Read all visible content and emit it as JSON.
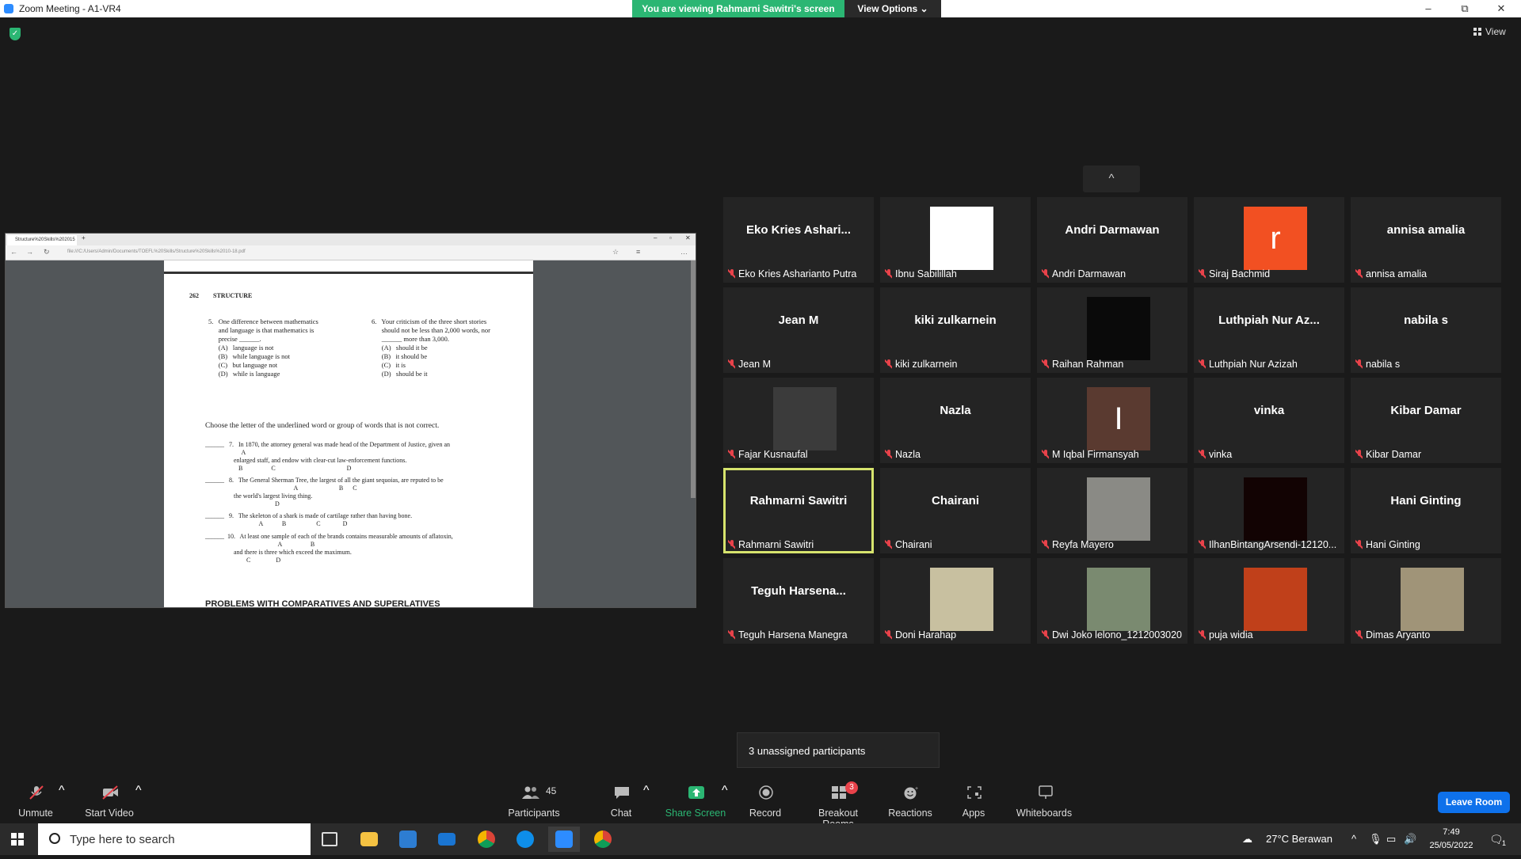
{
  "window": {
    "title": "Zoom Meeting - A1-VR4",
    "banner": "You are viewing Rahmarni Sawitri's screen",
    "view_options": "View Options ⌄",
    "view_label": "View",
    "controls": [
      "–",
      "⧉",
      "✕"
    ]
  },
  "shared_screen": {
    "tab_title": "Structure%20Skills%202015",
    "url": "file:///C:/Users/Admin/Documents/TOEFL%20Skills/Structure%20Skills%2010-18.pdf",
    "page_number": "262",
    "section": "STRUCTURE",
    "q5_lines": "5.   One difference between mathematics\n      and language is that mathematics is\n      precise ______.\n      (A)   language is not\n      (B)   while language is not\n      (C)   but language not\n      (D)   while is language",
    "q6_lines": "6.   Your criticism of the three short stories\n      should not be less than 2,000 words, nor\n      ______ more than 3,000.\n      (A)   should it be\n      (B)   it should be\n      (C)   it is\n      (D)   should be it",
    "instruction": "Choose the letter of the underlined word or group of words that is not correct.",
    "q7": "______   7.   In 1870, the attorney general was made head of the Department of Justice, given an\n                       A\n                  enlarged staff, and endow with clear-cut law-enforcement functions.\n                     B                  C                                             D",
    "q8": "______   8.   The General Sherman Tree, the largest of all the giant sequoias, are reputed to be\n                                                        A                          B      C\n                  the world's largest living thing.\n                                            D",
    "q9": "______   9.   The skeleton of a shark is made of cartilage rather than having bone.\n                                  A            B                   C              D",
    "q10": "______  10.   At least one sample of each of the brands contains measurable amounts of aflatoxin,\n                                              A                  B\n                  and there is three which exceed the maximum.\n                          C                D",
    "footer_heading": "PROBLEMS WITH COMPARATIVES AND SUPERLATIVES"
  },
  "gallery": {
    "up_arrow": "^",
    "participants": [
      {
        "display": "Eko Kries Ashari...",
        "name": "Eko Kries Asharianto Putra",
        "video": ""
      },
      {
        "display": "",
        "name": "Ibnu Sabilillah",
        "video": "#ffffff"
      },
      {
        "display": "Andri Darmawan",
        "name": "Andri Darmawan",
        "video": ""
      },
      {
        "display": "r",
        "name": "Siraj Bachmid",
        "video": "#f25022"
      },
      {
        "display": "annisa amalia",
        "name": "annisa amalia",
        "video": ""
      },
      {
        "display": "Jean M",
        "name": "Jean M",
        "video": ""
      },
      {
        "display": "kiki zulkarnein",
        "name": "kiki zulkarnein",
        "video": ""
      },
      {
        "display": "",
        "name": "Raihan Rahman",
        "video": "#0a0a0a"
      },
      {
        "display": "Luthpiah Nur Az...",
        "name": "Luthpiah Nur Azizah",
        "video": ""
      },
      {
        "display": "nabila s",
        "name": "nabila s",
        "video": ""
      },
      {
        "display": "",
        "name": "Fajar Kusnaufal",
        "video": "#3b3b3b"
      },
      {
        "display": "Nazla",
        "name": "Nazla",
        "video": ""
      },
      {
        "display": "I",
        "name": "M Iqbal Firmansyah",
        "video": "#5a3a30"
      },
      {
        "display": "vinka",
        "name": "vinka",
        "video": ""
      },
      {
        "display": "Kibar Damar",
        "name": "Kibar Damar",
        "video": ""
      },
      {
        "display": "Rahmarni Sawitri",
        "name": "Rahmarni Sawitri",
        "video": "",
        "active": true
      },
      {
        "display": "Chairani",
        "name": "Chairani",
        "video": ""
      },
      {
        "display": "",
        "name": "Reyfa Mayero",
        "video": "#8a8a85"
      },
      {
        "display": "",
        "name": "IlhanBintangArsendi-12120...",
        "video": "#120303"
      },
      {
        "display": "Hani Ginting",
        "name": "Hani Ginting",
        "video": ""
      },
      {
        "display": "Teguh Harsena...",
        "name": "Teguh Harsena Manegra",
        "video": ""
      },
      {
        "display": "",
        "name": "Doni Harahap",
        "video": "#c8c0a0"
      },
      {
        "display": "",
        "name": "Dwi Joko lelono_1212003020",
        "video": "#7a8a70"
      },
      {
        "display": "",
        "name": "puja widia",
        "video": "#c0401a"
      },
      {
        "display": "",
        "name": "Dimas Aryanto",
        "video": "#a09478"
      }
    ]
  },
  "unassigned": "3 unassigned participants",
  "toolbar": {
    "unmute": "Unmute",
    "start_video": "Start Video",
    "participants": "Participants",
    "participants_count": "45",
    "chat": "Chat",
    "share_screen": "Share Screen",
    "record": "Record",
    "breakout": "Breakout Rooms",
    "breakout_badge": "3",
    "reactions": "Reactions",
    "apps": "Apps",
    "whiteboards": "Whiteboards",
    "leave": "Leave Room"
  },
  "taskbar": {
    "search_placeholder": "Type here to search",
    "weather": "27°C  Berawan",
    "time": "7:49",
    "date": "25/05/2022",
    "notification_count": "1"
  }
}
